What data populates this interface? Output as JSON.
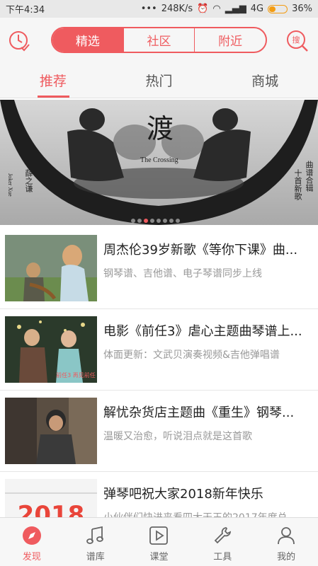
{
  "statusbar": {
    "time": "下午4:34",
    "speed": "248K/s",
    "network": "4G",
    "battery": "36%",
    "battery_level": 0.36
  },
  "header": {
    "segments": [
      "精选",
      "社区",
      "附近"
    ],
    "search_label": "搜"
  },
  "tabs": [
    "推荐",
    "热门",
    "商城"
  ],
  "banner": {
    "title_cn": "渡",
    "title_en": "The Crossing",
    "artist_cn": "薛之谦",
    "artist_en": "Joker Xue",
    "note_line1": "曲谱合辑",
    "note_line2": "十首新歌",
    "dot_count": 8,
    "active_dot": 2
  },
  "items": [
    {
      "title": "周杰伦39岁新歌《等你下课》曲...",
      "subtitle": "钢琴谱、吉他谱、电子琴谱同步上线"
    },
    {
      "title": "电影《前任3》虐心主题曲琴谱上...",
      "subtitle": "体面更新：文武贝演奏视频&吉他弹唱谱"
    },
    {
      "title": "解忧杂货店主题曲《重生》钢琴...",
      "subtitle": "温暖又治愈，听说泪点就是这首歌"
    },
    {
      "title": "弹琴吧祝大家2018新年快乐",
      "subtitle": "小伙伴们快进来看四大天王的2017年度总..."
    }
  ],
  "thumb_text": {
    "poster_small": "前任3 再见前任",
    "year": "2018"
  },
  "nav": [
    "发现",
    "谱库",
    "课堂",
    "工具",
    "我的"
  ],
  "colors": {
    "accent": "#ef5b5f"
  }
}
